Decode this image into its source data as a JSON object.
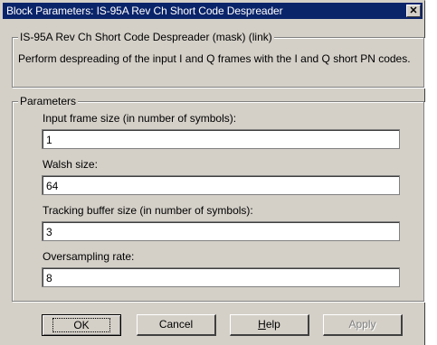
{
  "window": {
    "title": "Block Parameters: IS-95A Rev Ch Short Code Despreader",
    "close_glyph": "✕"
  },
  "mask_group": {
    "legend": "IS-95A Rev Ch Short Code Despreader (mask) (link)",
    "description": "Perform despreading of the input I and Q frames with the I and Q short PN codes."
  },
  "params_group": {
    "legend": "Parameters",
    "fields": [
      {
        "label": "Input frame size (in number of symbols):",
        "value": "1"
      },
      {
        "label": "Walsh size:",
        "value": "64"
      },
      {
        "label": "Tracking buffer size (in number of symbols):",
        "value": "3"
      },
      {
        "label": "Oversampling rate:",
        "value": "8"
      }
    ]
  },
  "buttons": {
    "ok": "OK",
    "cancel": "Cancel",
    "help_first": "H",
    "help_rest": "elp",
    "apply": "Apply"
  }
}
